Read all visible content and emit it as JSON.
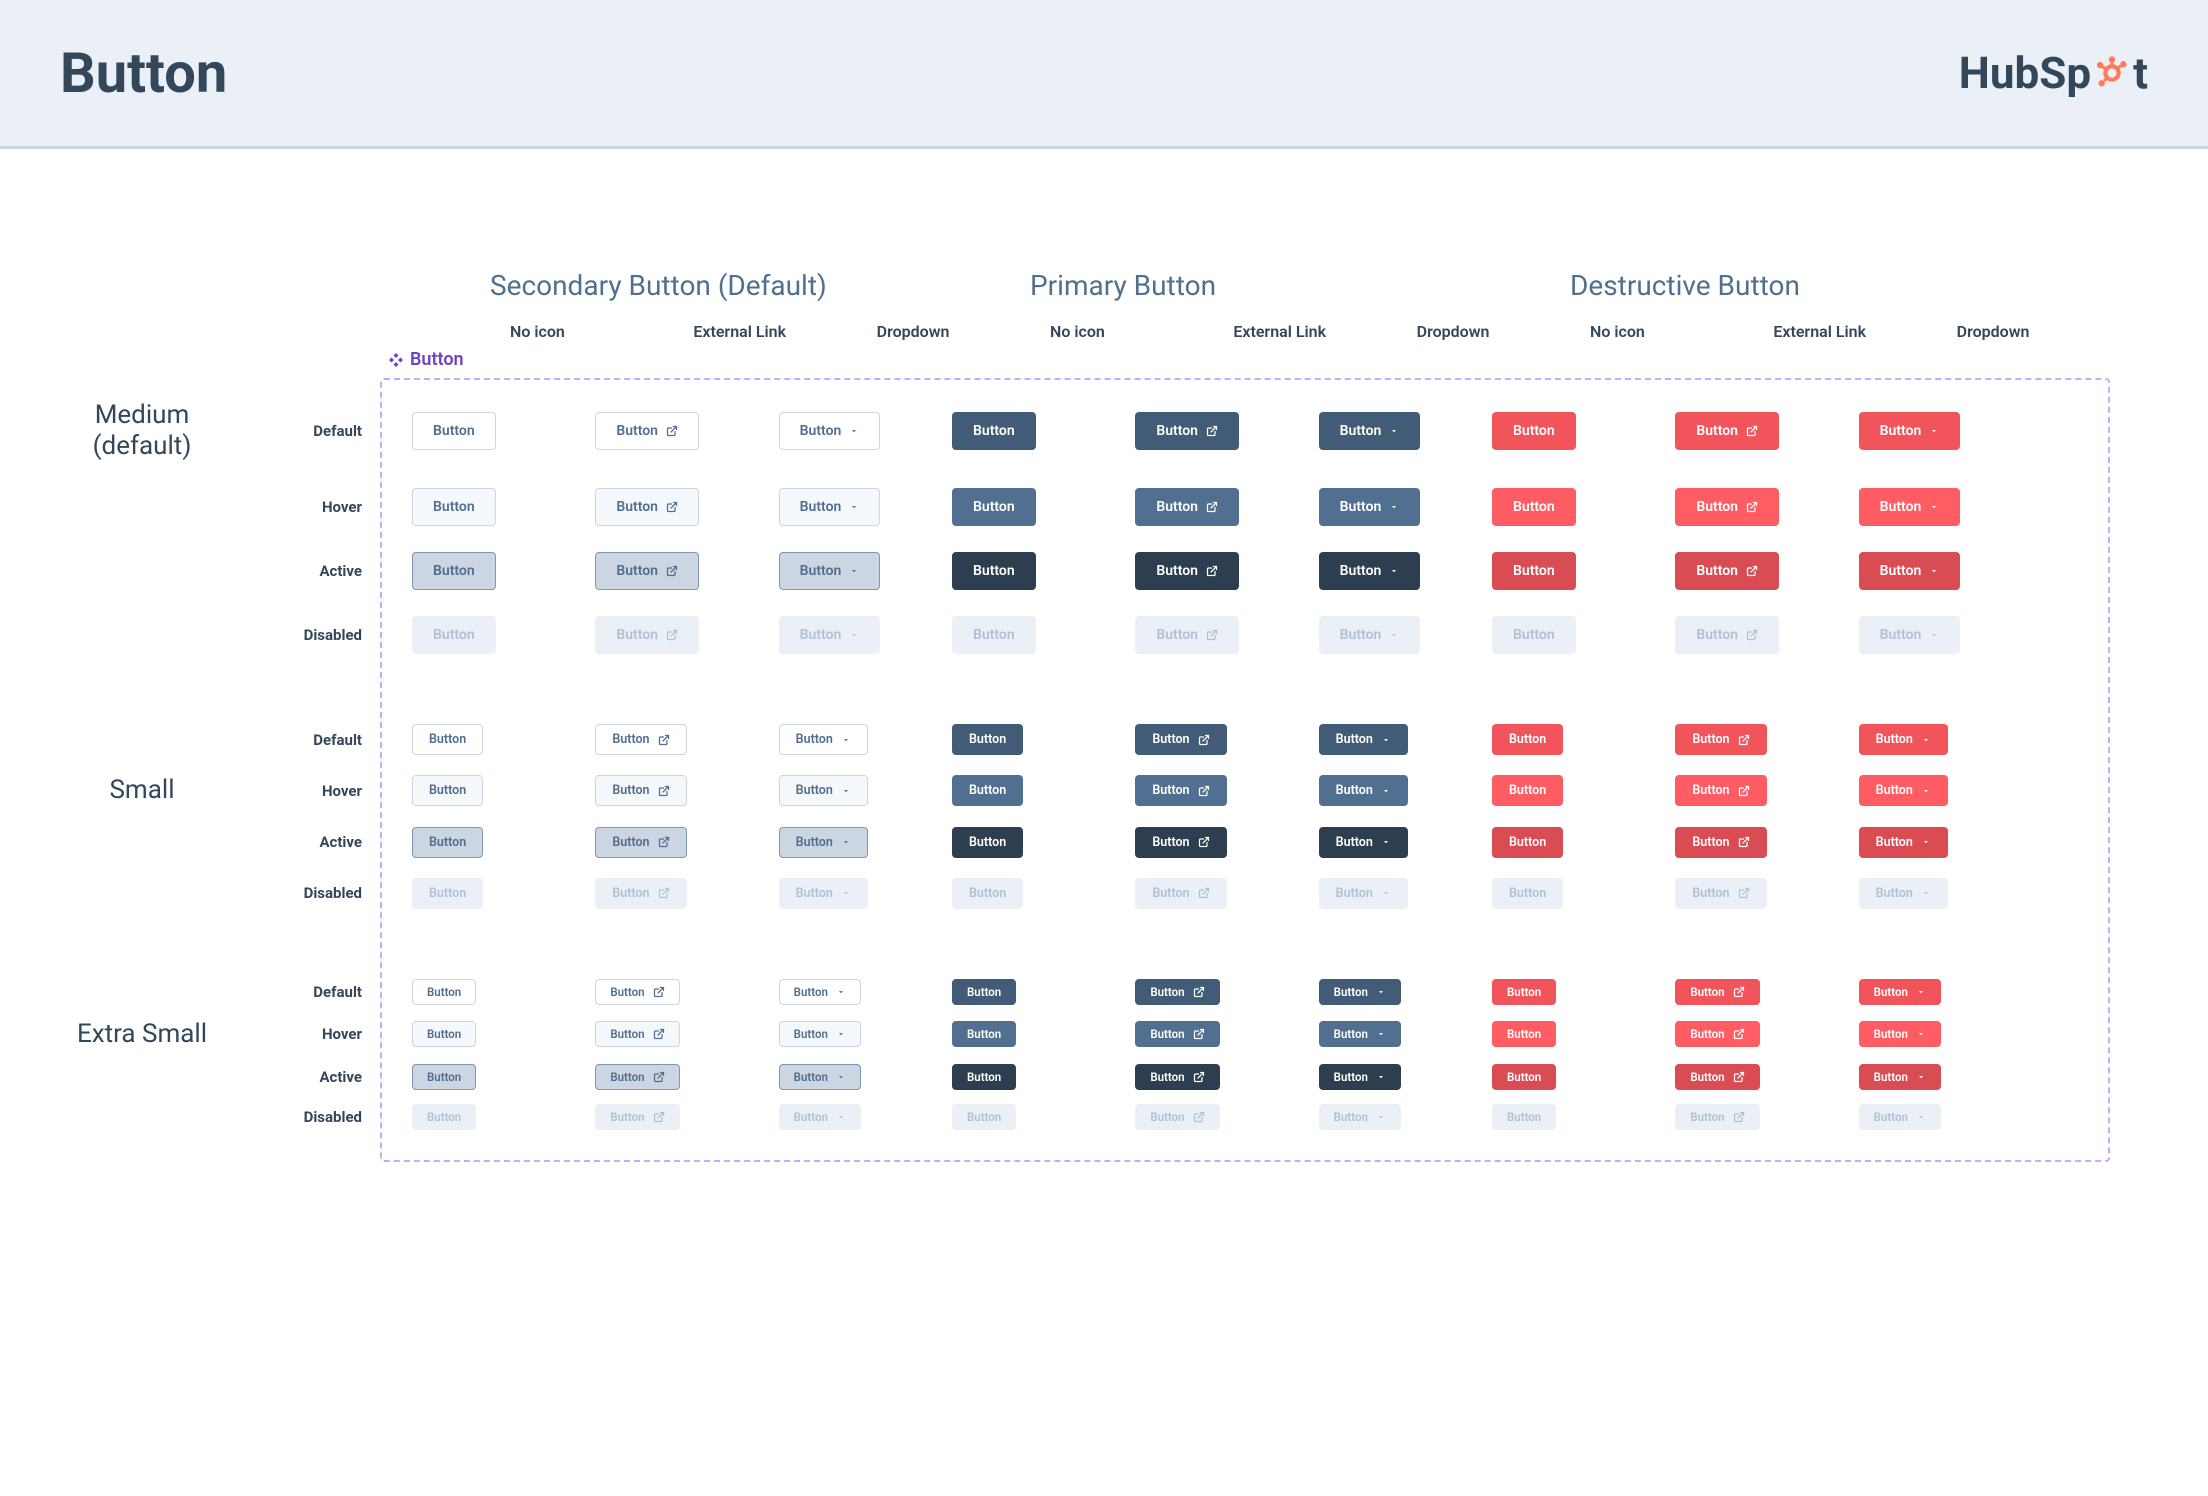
{
  "page_title": "Button",
  "brand": "HubSpot",
  "component_name": "Button",
  "button_label": "Button",
  "groups": [
    {
      "id": "secondary",
      "label": "Secondary Button (Default)"
    },
    {
      "id": "primary",
      "label": "Primary Button"
    },
    {
      "id": "destructive",
      "label": "Destructive Button"
    }
  ],
  "variants": [
    {
      "id": "noicon",
      "label": "No icon"
    },
    {
      "id": "external",
      "label": "External Link"
    },
    {
      "id": "dropdown",
      "label": "Dropdown"
    }
  ],
  "sizes": [
    {
      "id": "md",
      "label": "Medium (default)"
    },
    {
      "id": "sm",
      "label": "Small"
    },
    {
      "id": "xs",
      "label": "Extra Small"
    }
  ],
  "states": [
    {
      "id": "default",
      "label": "Default"
    },
    {
      "id": "hover",
      "label": "Hover"
    },
    {
      "id": "active",
      "label": "Active"
    },
    {
      "id": "disabled",
      "label": "Disabled"
    }
  ],
  "colors": {
    "brand_orange": "#ff7a59",
    "navy": "#33475b",
    "purple": "#6f42c1"
  }
}
